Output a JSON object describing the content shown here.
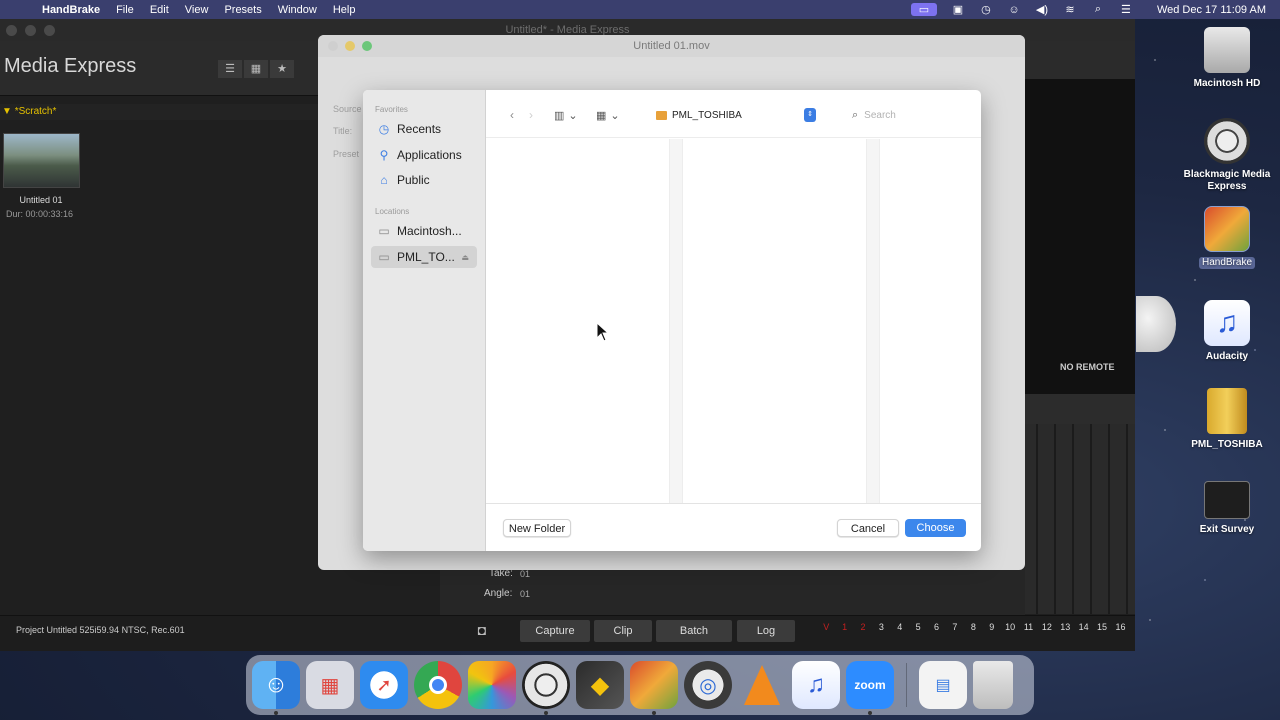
{
  "menubar": {
    "app_name": "HandBrake",
    "menus": [
      "File",
      "Edit",
      "View",
      "Presets",
      "Window",
      "Help"
    ],
    "clock": "Wed Dec 17  11:09 AM"
  },
  "media_express": {
    "window_title": "Untitled* - Media Express",
    "brand": "Media Express",
    "bin_name": "*Scratch*",
    "clip_name": "Untitled 01",
    "clip_duration": "Dur: 00:00:33:16",
    "no_remote": "NO REMOTE",
    "take_label": "Take:",
    "take_value": "01",
    "angle_label": "Angle:",
    "angle_value": "01",
    "project_info": "Project Untitled  525i59.94 NTSC, Rec.601",
    "buttons": [
      "Capture",
      "Clip",
      "Batch",
      "Log"
    ],
    "tracks": [
      "V",
      "1",
      "2",
      "3",
      "4",
      "5",
      "6",
      "7",
      "8",
      "9",
      "10",
      "11",
      "12",
      "13",
      "14",
      "15",
      "16"
    ]
  },
  "handbrake": {
    "window_title": "Untitled 01.mov",
    "side_labels": [
      "Source",
      "Title:",
      "Preset"
    ]
  },
  "dialog": {
    "favorites_header": "Favorites",
    "favorites": [
      {
        "label": "Recents",
        "icon": "clock-icon"
      },
      {
        "label": "Applications",
        "icon": "applications-icon"
      },
      {
        "label": "Public",
        "icon": "house-icon"
      }
    ],
    "locations_header": "Locations",
    "locations": [
      {
        "label": "Macintosh...",
        "icon": "drive-icon"
      },
      {
        "label": "PML_TO...",
        "icon": "drive-icon",
        "selected": true
      }
    ],
    "current_folder": "PML_TOSHIBA",
    "search_placeholder": "Search",
    "new_folder": "New Folder",
    "cancel": "Cancel",
    "choose": "Choose"
  },
  "desktop": {
    "icons": [
      {
        "label": "Macintosh HD",
        "icon": "hard-drive-icon"
      },
      {
        "label": "Blackmagic Media Express",
        "icon": "film-reel-icon"
      },
      {
        "label": "HandBrake",
        "icon": "handbrake-icon"
      },
      {
        "label": "Audacity",
        "icon": "headphones-icon"
      },
      {
        "label": "PML_TOSHIBA",
        "icon": "external-drive-icon"
      },
      {
        "label": "Exit Survey",
        "icon": "terminal-icon"
      }
    ]
  },
  "dock": {
    "apps": [
      "finder-icon",
      "launchpad-icon",
      "safari-icon",
      "chrome-icon",
      "photos-icon",
      "media-express-icon",
      "davinci-icon",
      "handbrake-icon",
      "quicktime-icon",
      "vlc-icon",
      "audacity-icon",
      "zoom-icon",
      "window-icon",
      "trash-icon"
    ],
    "zoom_label": "zoom"
  },
  "colors": {
    "menubar": "#3a3f6e",
    "accent_blue": "#3c87ec",
    "scratch_yellow": "#e6c200",
    "track_red": "#c42020"
  }
}
